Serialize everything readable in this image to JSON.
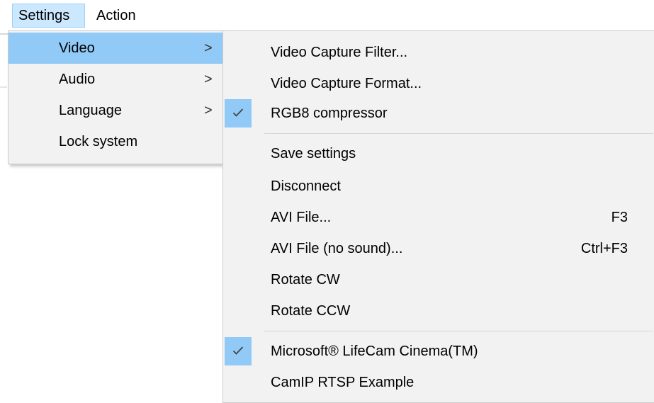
{
  "menubar": {
    "items": [
      {
        "label": "Settings",
        "open": true
      },
      {
        "label": "Action",
        "open": false
      }
    ]
  },
  "settings_menu": {
    "items": [
      {
        "label": "Video",
        "has_submenu": true,
        "highlighted": true
      },
      {
        "label": "Audio",
        "has_submenu": true,
        "highlighted": false
      },
      {
        "label": "Language",
        "has_submenu": true,
        "highlighted": false
      },
      {
        "label": "Lock system",
        "has_submenu": false,
        "highlighted": false
      }
    ],
    "submenu_arrow": ">"
  },
  "video_submenu": {
    "items": [
      {
        "label": "Video Capture Filter...",
        "shortcut": "",
        "checked": false
      },
      {
        "label": "Video Capture Format...",
        "shortcut": "",
        "checked": false
      },
      {
        "label": "RGB8 compressor",
        "shortcut": "",
        "checked": true
      },
      {
        "label": "Save settings",
        "shortcut": "",
        "checked": false
      },
      {
        "label": "Disconnect",
        "shortcut": "",
        "checked": false
      },
      {
        "label": "AVI File...",
        "shortcut": "F3",
        "checked": false
      },
      {
        "label": "AVI File (no sound)...",
        "shortcut": "Ctrl+F3",
        "checked": false
      },
      {
        "label": "Rotate CW",
        "shortcut": "",
        "checked": false
      },
      {
        "label": "Rotate CCW",
        "shortcut": "",
        "checked": false
      },
      {
        "label": "Microsoft® LifeCam Cinema(TM)",
        "shortcut": "",
        "checked": true
      },
      {
        "label": "CamIP RTSP Example",
        "shortcut": "",
        "checked": false
      }
    ]
  },
  "colors": {
    "menubar_open_bg": "#cce8ff",
    "menubar_open_border": "#99d1ff",
    "menu_bg": "#f2f2f2",
    "highlight": "#91c9f7",
    "separator": "#d7d7d7"
  },
  "icons": {
    "check": "checkmark-icon",
    "submenu": "chevron-right-icon"
  }
}
